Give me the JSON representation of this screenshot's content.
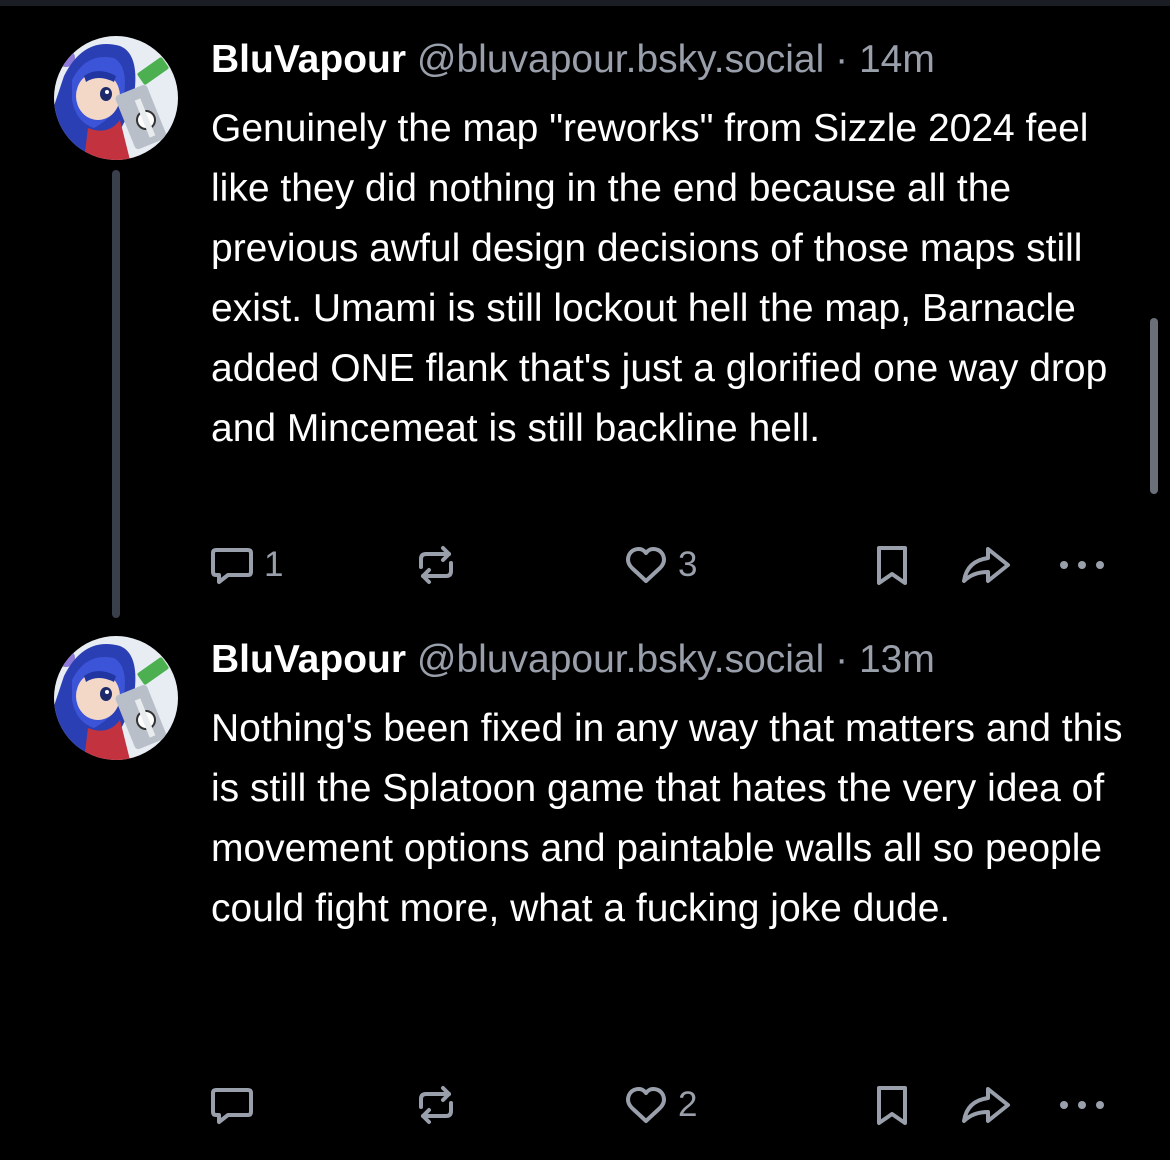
{
  "colors": {
    "background": "#000000",
    "text": "#ffffff",
    "muted": "#9aa0ab",
    "thread_line": "#3a3f4c"
  },
  "posts": [
    {
      "display_name": "BluVapour",
      "handle": "@bluvapour.bsky.social",
      "separator": "·",
      "time": "14m",
      "text": "Genuinely the map \"reworks\" from Sizzle 2024 feel like they did nothing in the end because all the previous awful design decisions of those maps still exist. Umami is still lockout hell the map, Barnacle added ONE flank that's just a glorified one way drop and Mincemeat is still backline hell.",
      "reply_count": "1",
      "repost_count": "",
      "like_count": "3"
    },
    {
      "display_name": "BluVapour",
      "handle": "@bluvapour.bsky.social",
      "separator": "·",
      "time": "13m",
      "text": "Nothing's been fixed in any way that matters and this is still the Splatoon game that hates the very idea of movement options and paintable walls all so people could fight more, what a fucking joke dude.",
      "reply_count": "",
      "repost_count": "",
      "like_count": "2"
    }
  ],
  "icons": {
    "reply": "reply-bubble-icon",
    "repost": "repost-icon",
    "like": "heart-icon",
    "bookmark": "bookmark-icon",
    "share": "share-arrow-icon",
    "more": "more-dots-icon"
  }
}
